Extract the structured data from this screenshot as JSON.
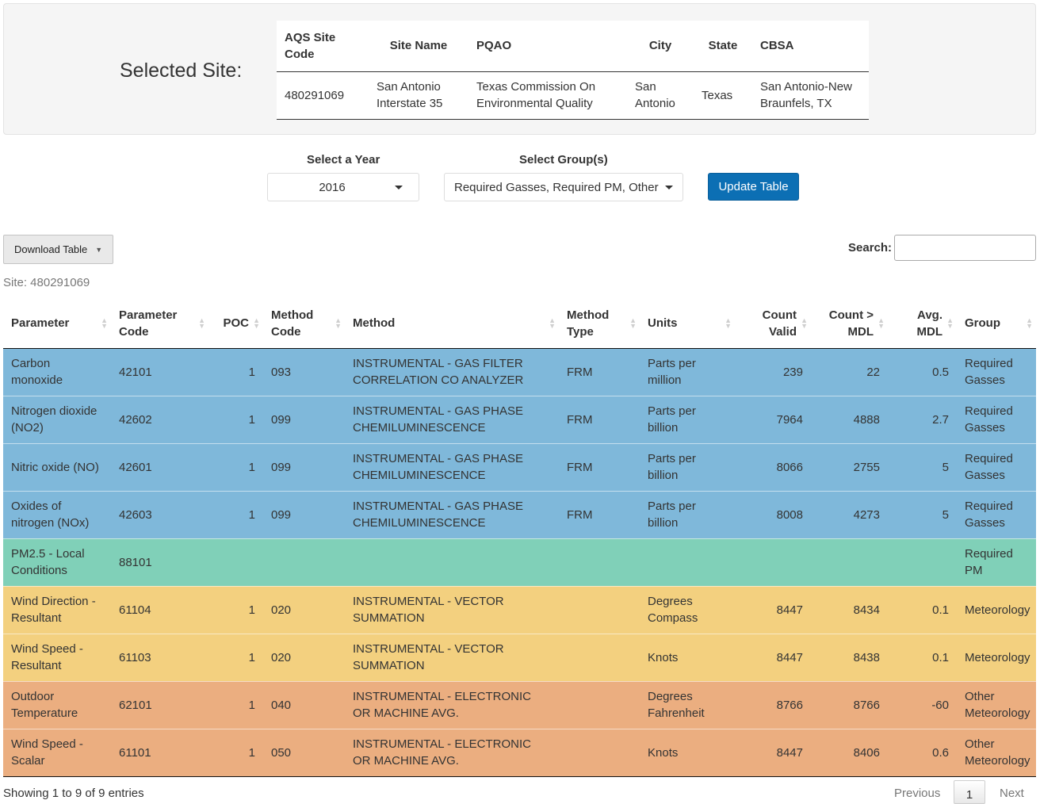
{
  "site_panel": {
    "label": "Selected Site:",
    "headers": [
      "AQS Site Code",
      "Site Name",
      "PQAO",
      "City",
      "State",
      "CBSA"
    ],
    "row": [
      "480291069",
      "San Antonio Interstate 35",
      "Texas Commission On Environmental Quality",
      "San Antonio",
      "Texas",
      "San Antonio-New Braunfels, TX"
    ]
  },
  "controls": {
    "year_label": "Select a Year",
    "year_value": "2016",
    "group_label": "Select Group(s)",
    "group_value": "Required Gasses, Required PM, Other M",
    "update_button": "Update Table",
    "download_button": "Download Table",
    "download_caret": "▼",
    "search_label": "Search:",
    "search_value": ""
  },
  "table_caption": "Site: 480291069",
  "table": {
    "headers": [
      "Parameter",
      "Parameter Code",
      "POC",
      "Method Code",
      "Method",
      "Method Type",
      "Units",
      "Count Valid",
      "Count > MDL",
      "Avg. MDL",
      "Group"
    ],
    "rows": [
      {
        "color": "#7fb8da",
        "cells": [
          "Carbon monoxide",
          "42101",
          "1",
          "093",
          "INSTRUMENTAL - GAS FILTER CORRELATION CO ANALYZER",
          "FRM",
          "Parts per million",
          "239",
          "22",
          "0.5",
          "Required Gasses"
        ]
      },
      {
        "color": "#7fb8da",
        "cells": [
          "Nitrogen dioxide (NO2)",
          "42602",
          "1",
          "099",
          "INSTRUMENTAL - GAS PHASE CHEMILUMINESCENCE",
          "FRM",
          "Parts per billion",
          "7964",
          "4888",
          "2.7",
          "Required Gasses"
        ]
      },
      {
        "color": "#7fb8da",
        "cells": [
          "Nitric oxide (NO)",
          "42601",
          "1",
          "099",
          "INSTRUMENTAL - GAS PHASE CHEMILUMINESCENCE",
          "FRM",
          "Parts per billion",
          "8066",
          "2755",
          "5",
          "Required Gasses"
        ]
      },
      {
        "color": "#7fb8da",
        "cells": [
          "Oxides of nitrogen (NOx)",
          "42603",
          "1",
          "099",
          "INSTRUMENTAL - GAS PHASE CHEMILUMINESCENCE",
          "FRM",
          "Parts per billion",
          "8008",
          "4273",
          "5",
          "Required Gasses"
        ]
      },
      {
        "color": "#80d0b8",
        "cells": [
          "PM2.5 - Local Conditions",
          "88101",
          "",
          "",
          "",
          "",
          "",
          "",
          "",
          "",
          "Required PM"
        ]
      },
      {
        "color": "#f3d07f",
        "cells": [
          "Wind Direction - Resultant",
          "61104",
          "1",
          "020",
          "INSTRUMENTAL - VECTOR SUMMATION",
          "",
          "Degrees Compass",
          "8447",
          "8434",
          "0.1",
          "Meteorology"
        ]
      },
      {
        "color": "#f3d07f",
        "cells": [
          "Wind Speed - Resultant",
          "61103",
          "1",
          "020",
          "INSTRUMENTAL - VECTOR SUMMATION",
          "",
          "Knots",
          "8447",
          "8438",
          "0.1",
          "Meteorology"
        ]
      },
      {
        "color": "#ebae80",
        "cells": [
          "Outdoor Temperature",
          "62101",
          "1",
          "040",
          "INSTRUMENTAL - ELECTRONIC OR MACHINE AVG.",
          "",
          "Degrees Fahrenheit",
          "8766",
          "8766",
          "-60",
          "Other Meteorology"
        ]
      },
      {
        "color": "#ebae80",
        "cells": [
          "Wind Speed - Scalar",
          "61101",
          "1",
          "050",
          "INSTRUMENTAL - ELECTRONIC OR MACHINE AVG.",
          "",
          "Knots",
          "8447",
          "8406",
          "0.6",
          "Other Meteorology"
        ]
      }
    ]
  },
  "footer": {
    "info": "Showing 1 to 9 of 9 entries",
    "previous": "Previous",
    "page": "1",
    "next": "Next"
  }
}
